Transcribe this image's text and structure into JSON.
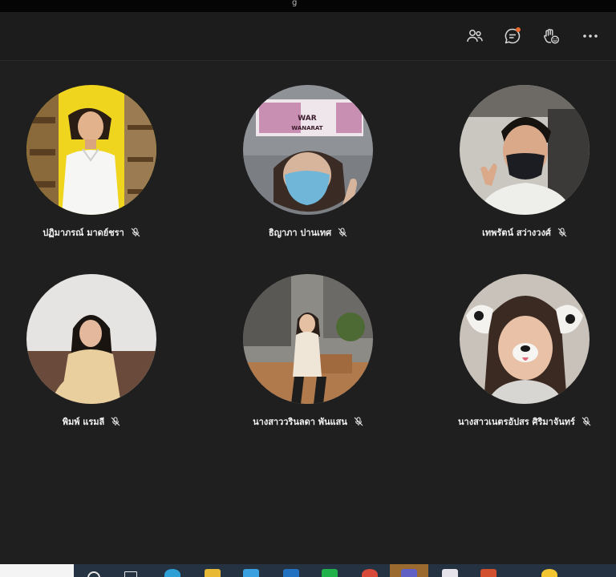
{
  "window": {
    "title_fragment": "g"
  },
  "toolbar": {
    "participants_icon": "people-icon",
    "chat_icon": "chat-icon",
    "reactions_icon": "raise-hand-icon",
    "more_icon": "more-icon",
    "chat_badge_color": "#e8692c"
  },
  "participants": [
    {
      "name": "ปฏิมาภรณ์ มาดย์ชรา",
      "muted": true
    },
    {
      "name": "ธิญาภา ปานเทศ",
      "muted": true
    },
    {
      "name": "เทพรัตน์ สว่างวงศ์",
      "muted": true
    },
    {
      "name": "พิมพ์ แรมลี",
      "muted": true
    },
    {
      "name": "นางสาววรินลดา พันแสน",
      "muted": true
    },
    {
      "name": "นางสาวเนตรอัปสร ศิริมาจันทร์",
      "muted": true
    }
  ],
  "video_overlay": {
    "line1": "WAR",
    "line2": "WANARAT"
  },
  "taskbar": {
    "items": [
      "search-icon",
      "task-view-icon",
      "edge-icon",
      "file-explorer-icon",
      "store-icon",
      "mail-icon",
      "line-icon",
      "chrome-icon",
      "teams-icon",
      "paint-icon",
      "powerpoint-icon",
      "emoji-icon"
    ],
    "active_item": "teams-icon"
  },
  "colors": {
    "background": "#1f1f1f",
    "toolbar": "#1c1c1c",
    "name_text": "#f2f2f2",
    "taskbar": "#253241",
    "teams_active": "#9b6a2e"
  }
}
